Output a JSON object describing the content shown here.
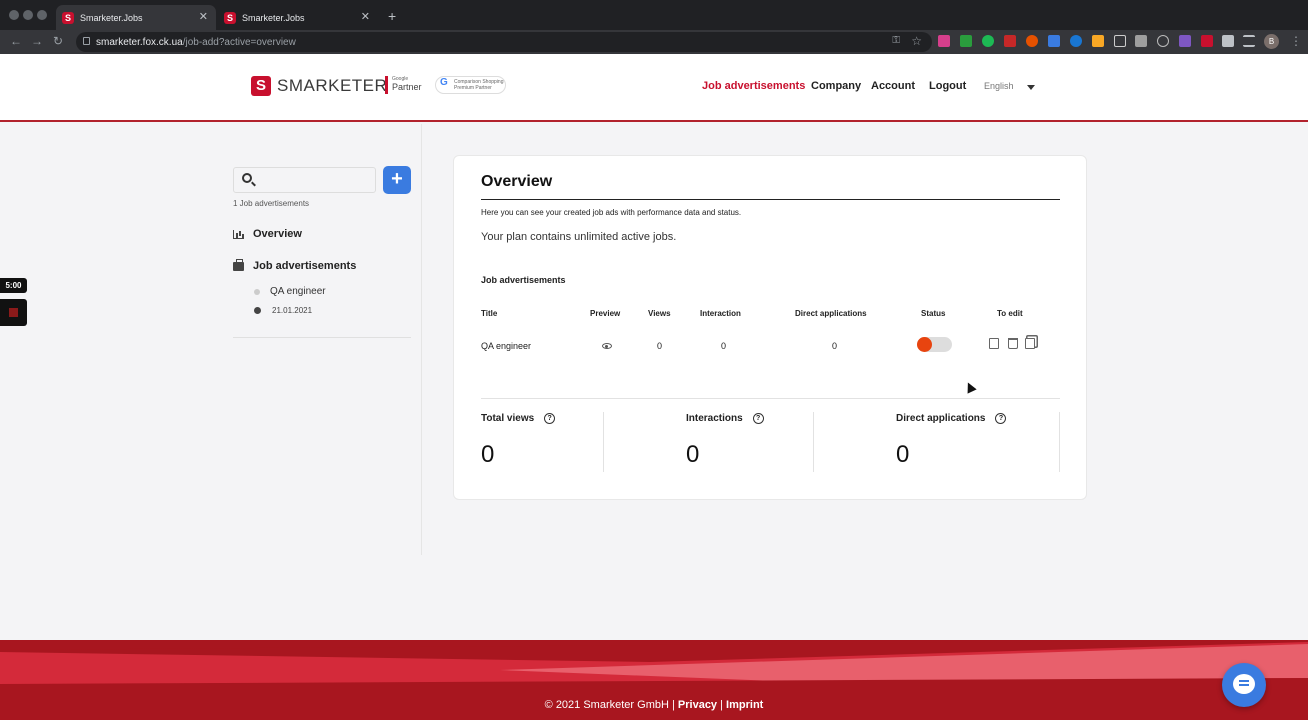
{
  "browser": {
    "tabs": [
      {
        "title": "Smarketer.Jobs",
        "active": true
      },
      {
        "title": "Smarketer.Jobs",
        "active": false
      }
    ],
    "url_host": "smarketer.fox.ck.ua",
    "url_path": "/job-add?active=overview",
    "profile_initial": "B"
  },
  "header": {
    "logo_text": "SMARKETER",
    "partner_top": "Google",
    "partner_bottom": "Partner",
    "premium_line1": "Comparison Shopping",
    "premium_line2": "Premium Partner",
    "nav": [
      "Job advertisements",
      "Company",
      "Account",
      "Logout"
    ],
    "active_nav": "Job advertisements",
    "language": "English"
  },
  "sidebar": {
    "search_placeholder": "",
    "job_count_label": "1 Job advertisements",
    "overview_label": "Overview",
    "job_ads_label": "Job advertisements",
    "job_title": "QA engineer",
    "job_date": "21.01.2021"
  },
  "overlay": {
    "timer": "5:00"
  },
  "main": {
    "title": "Overview",
    "description": "Here you can see your created job ads with performance data and status.",
    "plan_text": "Your plan contains unlimited active jobs.",
    "section_title": "Job advertisements",
    "columns": [
      "Title",
      "Preview",
      "Views",
      "Interaction",
      "Direct applications",
      "Status",
      "To edit"
    ],
    "rows": [
      {
        "title": "QA engineer",
        "views": "0",
        "interaction": "0",
        "direct_applications": "0",
        "status_active": false
      }
    ],
    "stats": [
      {
        "label": "Total views",
        "value": "0"
      },
      {
        "label": "Interactions",
        "value": "0"
      },
      {
        "label": "Direct applications",
        "value": "0"
      }
    ]
  },
  "footer": {
    "copyright": "© 2021 Smarketer GmbH |",
    "privacy": "Privacy",
    "separator": "|",
    "imprint": "Imprint"
  },
  "colors": {
    "brand_red": "#c8102e",
    "accent_blue": "#3a7be0",
    "toggle_orange": "#e8440f"
  }
}
